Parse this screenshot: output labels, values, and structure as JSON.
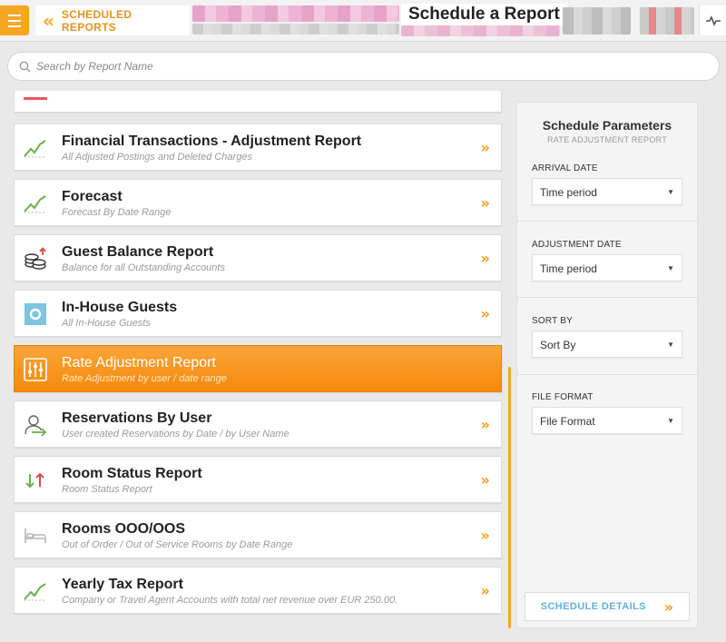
{
  "header": {
    "back_label": "SCHEDULED REPORTS",
    "title": "Schedule a Report"
  },
  "search": {
    "placeholder": "Search by Report Name"
  },
  "reports": [
    {
      "title": "Financial Transactions - Adjustment Report",
      "subtitle": "All Adjusted Postings and Deleted Charges",
      "icon": "trend-chart-icon"
    },
    {
      "title": "Forecast",
      "subtitle": "Forecast By Date Range",
      "icon": "trend-chart-icon"
    },
    {
      "title": "Guest Balance Report",
      "subtitle": "Balance for all Outstanding Accounts",
      "icon": "coin-stack-icon"
    },
    {
      "title": "In-House Guests",
      "subtitle": "All In-House Guests",
      "icon": "in-house-icon"
    },
    {
      "title": "Rate Adjustment Report",
      "subtitle": "Rate Adjustment by user / date range",
      "icon": "sliders-icon",
      "selected": true
    },
    {
      "title": "Reservations By User",
      "subtitle": "User created Reservations by Date / by User Name",
      "icon": "user-arrow-icon"
    },
    {
      "title": "Room Status Report",
      "subtitle": "Room Status Report",
      "icon": "up-down-arrows-icon"
    },
    {
      "title": "Rooms OOO/OOS",
      "subtitle": "Out of Order / Out of Service Rooms by Date Range",
      "icon": "bed-icon"
    },
    {
      "title": "Yearly Tax Report",
      "subtitle": "Company or Travel Agent Accounts with total net revenue over EUR 250.00.",
      "icon": "trend-chart-icon"
    }
  ],
  "panel": {
    "title": "Schedule Parameters",
    "subtitle": "RATE ADJUSTMENT REPORT",
    "params": [
      {
        "label": "ARRIVAL DATE",
        "value": "Time period"
      },
      {
        "label": "ADJUSTMENT DATE",
        "value": "Time period"
      },
      {
        "label": "SORT BY",
        "value": "Sort By"
      },
      {
        "label": "FILE FORMAT",
        "value": "File Format"
      }
    ],
    "details_label": "SCHEDULE DETAILS"
  },
  "colors": {
    "accent": "#f6a623",
    "selected_row": "#f5890a",
    "link_blue": "#5fb3d9",
    "chart_green": "#6ab04c",
    "arrow_red": "#e04848",
    "tile_blue": "#7fc4e0"
  }
}
